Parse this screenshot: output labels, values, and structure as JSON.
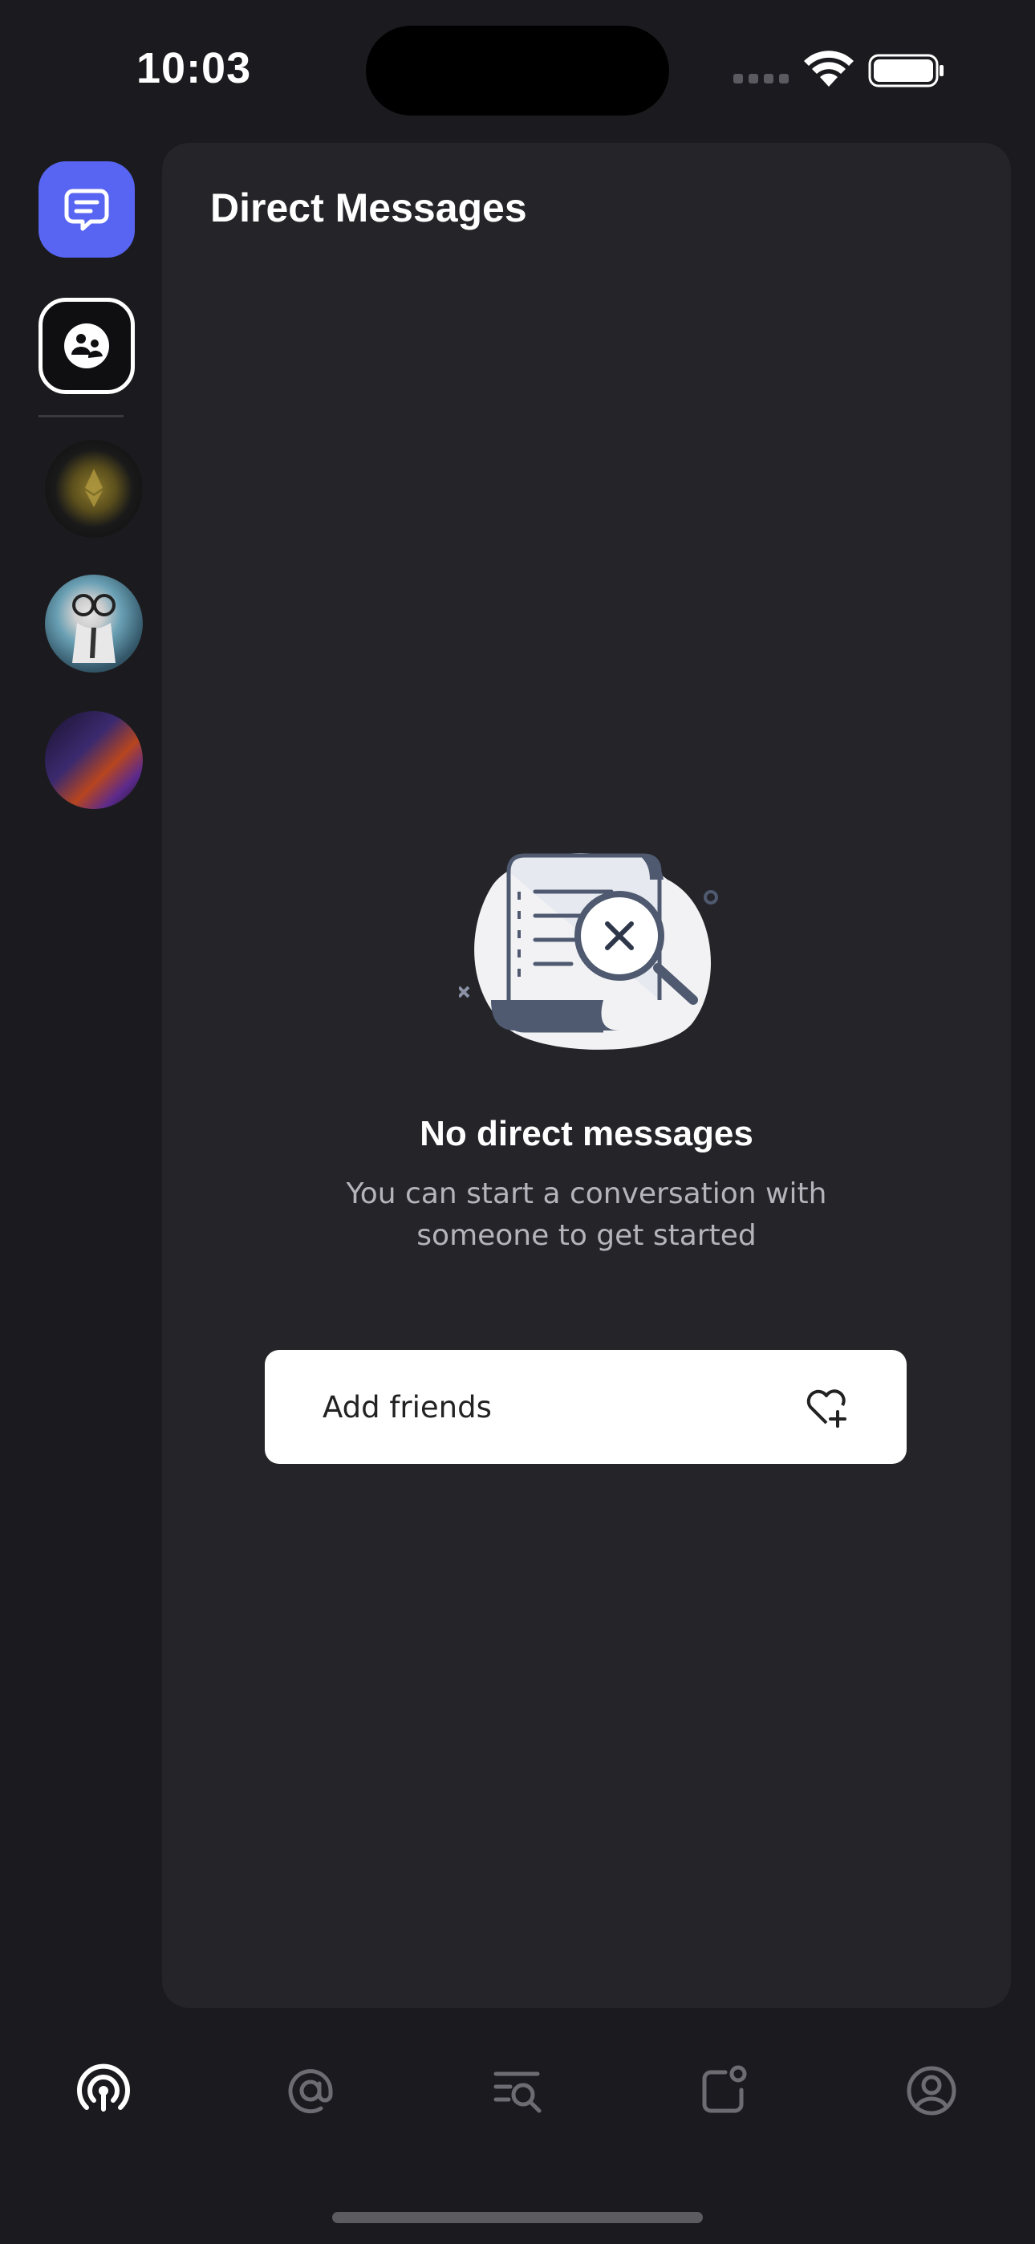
{
  "status_bar": {
    "time": "10:03"
  },
  "rail": {
    "active_item_icon": "chat-bubble-icon",
    "friends_item_icon": "friends-icon",
    "servers": [
      {
        "icon": "server-avatar-coin"
      },
      {
        "icon": "server-avatar-cartoon"
      },
      {
        "icon": "server-avatar-abstract"
      }
    ]
  },
  "main": {
    "title": "Direct Messages",
    "empty_state": {
      "title": "No direct messages",
      "subtitle_line1": "You can start a conversation with",
      "subtitle_line2": "someone to get started"
    },
    "add_friends_button": {
      "label": "Add friends",
      "icon": "heart-plus-icon"
    }
  },
  "tabbar": {
    "tabs": [
      {
        "icon": "broadcast-icon",
        "active": true
      },
      {
        "icon": "at-mention-icon",
        "active": false
      },
      {
        "icon": "list-search-icon",
        "active": false
      },
      {
        "icon": "notification-icon",
        "active": false
      },
      {
        "icon": "profile-icon",
        "active": false
      }
    ]
  },
  "colors": {
    "background": "#1b1b1f",
    "panel": "#242429",
    "accent": "#5865f2",
    "text_primary": "#ffffff",
    "text_secondary": "#b4b4ba",
    "tab_inactive": "#6c6c72"
  }
}
